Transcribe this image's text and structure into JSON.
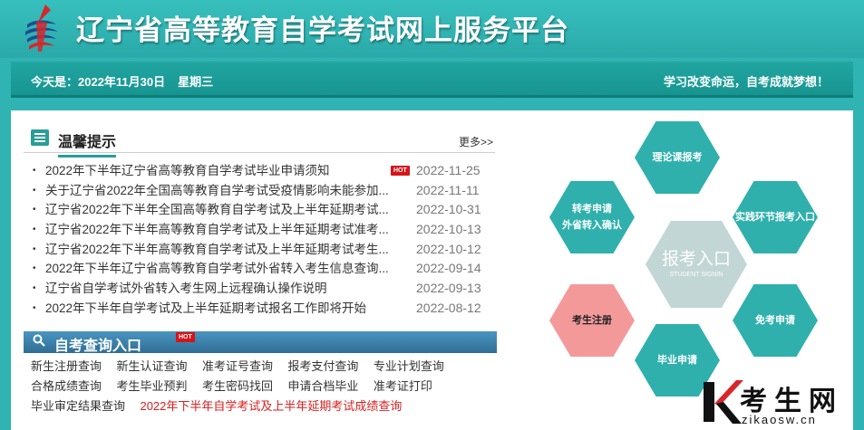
{
  "header": {
    "title": "辽宁省高等教育自学考试网上服务平台"
  },
  "datebar": {
    "date": "今天是：2022年11月30日",
    "weekday": "星期三",
    "slogan": "学习改变命运，自考成就梦想！"
  },
  "notice": {
    "title": "温馨提示",
    "more": "更多>>",
    "hot_label": "HOT",
    "items": [
      {
        "title": "2022年下半年辽宁省高等教育自学考试毕业申请须知",
        "date": "2022-11-25",
        "hot": true
      },
      {
        "title": "关于辽宁省2022年全国高等教育自学考试受疫情影响未能参加...",
        "date": "2022-11-11"
      },
      {
        "title": "辽宁省2022年下半年全国高等教育自学考试及上半年延期考试...",
        "date": "2022-10-31"
      },
      {
        "title": "辽宁省2022年下半年高等教育自学考试及上半年延期考试准考...",
        "date": "2022-10-13"
      },
      {
        "title": "辽宁省2022年下半年高等教育自学考试及上半年延期考试考生...",
        "date": "2022-10-12"
      },
      {
        "title": "2022年下半年辽宁省高等教育自学考试外省转入考生信息查询...",
        "date": "2022-09-14"
      },
      {
        "title": "辽宁省自学考试外省转入考生网上远程确认操作说明",
        "date": "2022-09-13"
      },
      {
        "title": "2022年下半年自学考试及上半年延期考试报名工作即将开始",
        "date": "2022-08-12"
      }
    ]
  },
  "query": {
    "title": "自考查询入口",
    "hot_label": "HOT",
    "rows": [
      [
        "新生注册查询",
        "新生认证查询",
        "准考证号查询",
        "报考支付查询",
        "专业计划查询"
      ],
      [
        "合格成绩查询",
        "考生毕业预判",
        "考生密码找回",
        "申请合档毕业",
        "准考证打印"
      ],
      [
        "毕业审定结果查询"
      ]
    ],
    "highlight_link": "2022年下半年自学考试及上半年延期考试成绩查询"
  },
  "hexagons": {
    "center_title": "报考入口",
    "center_subtitle": "STUDENT SIGNIN",
    "top": "理论课报考",
    "upper_left_line1": "转考申请",
    "upper_left_line2": "外省转入确认",
    "upper_right": "实践环节报考入口",
    "lower_left": "考生注册",
    "lower_right": "免考申请",
    "bottom": "毕业申请"
  },
  "watermark": {
    "text": "考生网",
    "url": "zikaosw.cn"
  },
  "colors": {
    "teal": "#2fb0ad",
    "dark_teal": "#16938f",
    "pink": "#f4999a",
    "hot_red": "#d4141a",
    "query_blue": "#2f6e96"
  }
}
